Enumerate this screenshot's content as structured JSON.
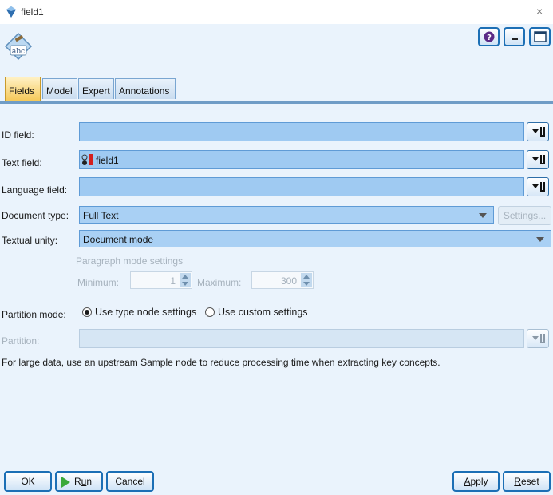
{
  "window": {
    "title": "field1",
    "close_glyph": "×"
  },
  "tabs": [
    {
      "label": "Fields",
      "active": true
    },
    {
      "label": "Model",
      "active": false
    },
    {
      "label": "Expert",
      "active": false
    },
    {
      "label": "Annotations",
      "active": false
    }
  ],
  "fields": {
    "id_field": {
      "label": "ID field:",
      "value": ""
    },
    "text_field": {
      "label": "Text field:",
      "value": "field1"
    },
    "language_field": {
      "label": "Language field:",
      "value": ""
    },
    "document_type": {
      "label": "Document type:",
      "value": "Full Text",
      "settings_label": "Settings..."
    },
    "textual_unity": {
      "label": "Textual unity:",
      "value": "Document mode"
    }
  },
  "paragraph": {
    "heading": "Paragraph mode settings",
    "minimum_label": "Minimum:",
    "minimum_value": "1",
    "maximum_label": "Maximum:",
    "maximum_value": "300"
  },
  "partition": {
    "mode_label": "Partition mode:",
    "option_type": "Use type node settings",
    "option_custom": "Use custom settings",
    "selected": "type",
    "field_label": "Partition:",
    "field_value": ""
  },
  "note": "For large data, use an upstream Sample node to reduce processing time when extracting key concepts.",
  "buttons": {
    "ok": "OK",
    "run_first": "R",
    "run_underlined": "u",
    "run_rest": "n",
    "cancel": "Cancel",
    "apply_underlined": "A",
    "apply_rest": "pply",
    "reset_underlined": "R",
    "reset_rest": "eset"
  },
  "icons": {
    "app": "text-mining-node-icon",
    "node": "abc-text-node-icon",
    "help": "help-icon",
    "minimize": "minimize-icon",
    "maximize": "maximize-icon",
    "field_picker": "field-picker-icon",
    "field_type": "field-type-icon",
    "run": "run-icon"
  },
  "colors": {
    "accent": "#1c6fb5",
    "field_bg": "#9fcaf2",
    "active_tab": "#f5c95a",
    "background": "#eaf3fc"
  }
}
